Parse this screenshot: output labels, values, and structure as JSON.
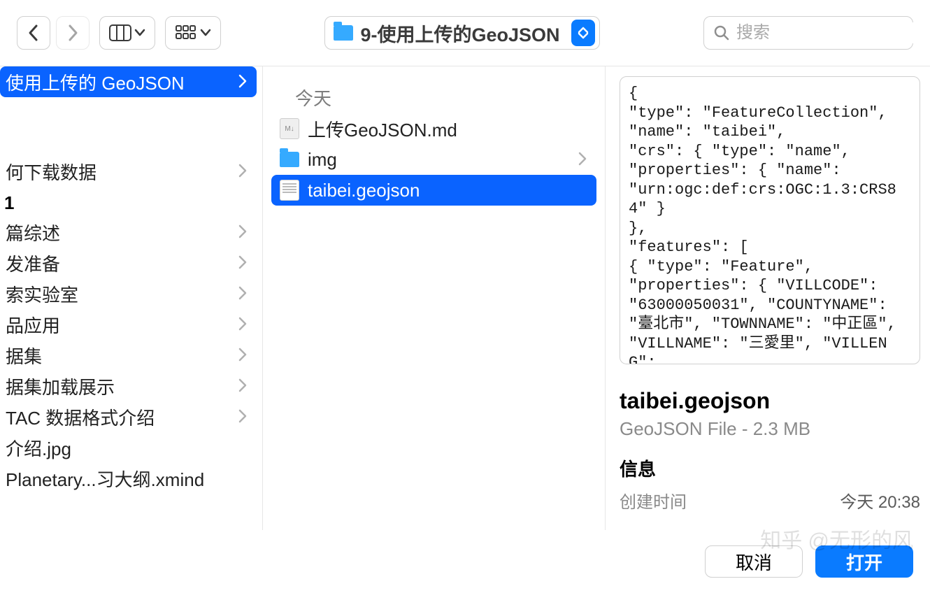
{
  "toolbar": {
    "path_label": "9-使用上传的GeoJSON",
    "search_placeholder": "搜索"
  },
  "col1": {
    "items": [
      {
        "label": "使用上传的 GeoJSON",
        "chevron": true,
        "selected": true
      },
      {
        "label": ""
      },
      {
        "label": "何下载数据",
        "chevron": true
      },
      {
        "group": "1"
      },
      {
        "label": "篇综述",
        "chevron": true
      },
      {
        "label": "发准备",
        "chevron": true
      },
      {
        "label": "索实验室",
        "chevron": true
      },
      {
        "label": "品应用",
        "chevron": true
      },
      {
        "label": "据集",
        "chevron": true
      },
      {
        "label": "据集加载展示",
        "chevron": true
      },
      {
        "label": "TAC 数据格式介绍",
        "chevron": true
      },
      {
        "label": "介绍.jpg"
      },
      {
        "label": "Planetary...习大纲.xmind"
      }
    ]
  },
  "col2": {
    "section": "今天",
    "items": [
      {
        "icon": "md",
        "label": "上传GeoJSON.md"
      },
      {
        "icon": "folder",
        "label": "img",
        "chevron": true
      },
      {
        "icon": "doc",
        "label": "taibei.geojson",
        "selected": true
      }
    ]
  },
  "preview_text": "{\n\"type\": \"FeatureCollection\",\n\"name\": \"taibei\",\n\"crs\": { \"type\": \"name\",\n\"properties\": { \"name\":\n\"urn:ogc:def:crs:OGC:1.3:CRS84\" }\n},\n\"features\": [\n{ \"type\": \"Feature\",\n\"properties\": { \"VILLCODE\":\n\"63000050031\", \"COUNTYNAME\": \"臺北市\", \"TOWNNAME\": \"中正區\",\n\"VILLNAME\": \"三愛里\", \"VILLENG\":\n\"San'ai Vil.\", \"COUNTYID\": \"A\",\n\"COUNTYCODE\": \"63000\", \"TOWNID\":\n\"A03\", \"TOWNCODE\": \"63000050\",\n\"NOTE\": null }, \"geometry\":\n{ \"type\": \"MultiPolygon\"",
  "detail": {
    "name": "taibei.geojson",
    "kind": "GeoJSON File - 2.3 MB",
    "info_header": "信息",
    "created_label": "创建时间",
    "created_value": "今天 20:38"
  },
  "footer": {
    "cancel": "取消",
    "open": "打开",
    "watermark": "知乎 @无形的风"
  }
}
